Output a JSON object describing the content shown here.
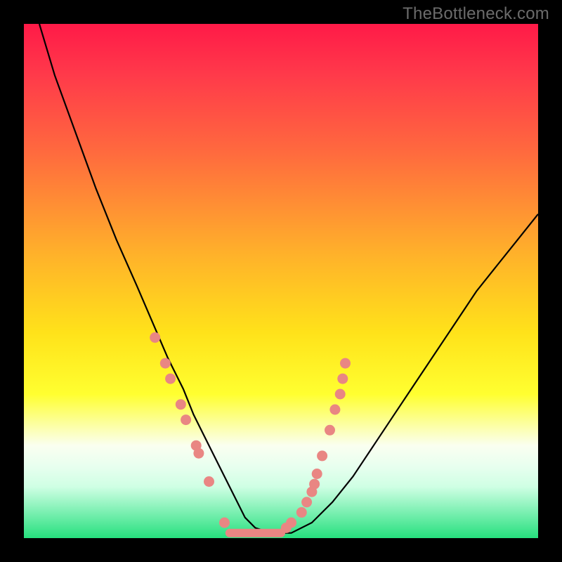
{
  "watermark": "TheBottleneck.com",
  "chart_data": {
    "type": "line",
    "title": "",
    "xlabel": "",
    "ylabel": "",
    "xlim": [
      0,
      100
    ],
    "ylim": [
      0,
      100
    ],
    "background_gradient": [
      "#ff1a48",
      "#ffff30",
      "#26e07e"
    ],
    "series": [
      {
        "name": "curve",
        "x": [
          3,
          6,
          10,
          14,
          18,
          22,
          25,
          28,
          31,
          33,
          35,
          37,
          39,
          41,
          43,
          45,
          48,
          52,
          56,
          60,
          64,
          68,
          72,
          76,
          80,
          84,
          88,
          92,
          96,
          100
        ],
        "values": [
          100,
          90,
          79,
          68,
          58,
          49,
          42,
          35,
          29,
          24,
          20,
          16,
          12,
          8,
          4,
          2,
          1,
          1,
          3,
          7,
          12,
          18,
          24,
          30,
          36,
          42,
          48,
          53,
          58,
          63
        ]
      }
    ],
    "annotations": {
      "flat_segment": {
        "x_start": 40,
        "x_end": 50,
        "y": 1
      },
      "points_left": [
        {
          "x": 25.5,
          "y": 39
        },
        {
          "x": 27.5,
          "y": 34
        },
        {
          "x": 28.5,
          "y": 31
        },
        {
          "x": 30.5,
          "y": 26
        },
        {
          "x": 31.5,
          "y": 23
        },
        {
          "x": 33.5,
          "y": 18
        },
        {
          "x": 34.0,
          "y": 16.5
        },
        {
          "x": 36.0,
          "y": 11
        },
        {
          "x": 39.0,
          "y": 3
        }
      ],
      "points_right": [
        {
          "x": 51.0,
          "y": 2
        },
        {
          "x": 52.0,
          "y": 3
        },
        {
          "x": 54.0,
          "y": 5
        },
        {
          "x": 55.0,
          "y": 7
        },
        {
          "x": 56.0,
          "y": 9
        },
        {
          "x": 56.5,
          "y": 10.5
        },
        {
          "x": 57.0,
          "y": 12.5
        },
        {
          "x": 58.0,
          "y": 16
        },
        {
          "x": 59.5,
          "y": 21
        },
        {
          "x": 60.5,
          "y": 25
        },
        {
          "x": 61.5,
          "y": 28
        },
        {
          "x": 62.0,
          "y": 31
        },
        {
          "x": 62.5,
          "y": 34
        }
      ]
    }
  }
}
